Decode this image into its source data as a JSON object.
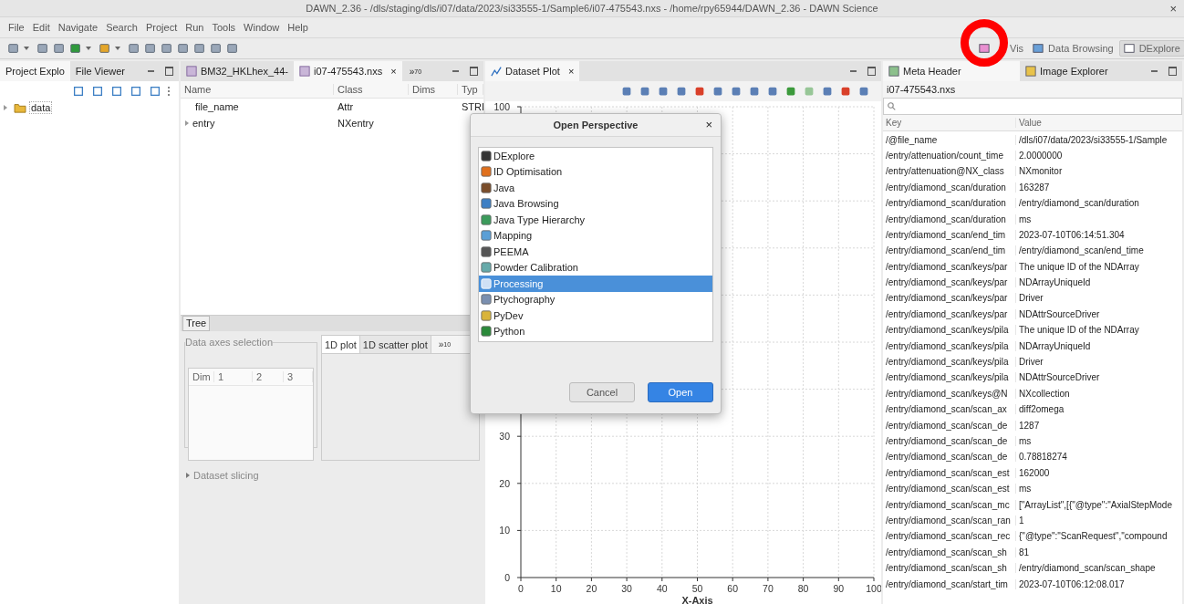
{
  "window": {
    "title": "DAWN_2.36 - /dls/staging/dls/i07/data/2023/si33555-1/Sample6/i07-475543.nxs - /home/rpy65944/DAWN_2.36 - DAWN Science",
    "close": "×"
  },
  "menu": [
    "File",
    "Edit",
    "Navigate",
    "Search",
    "Project",
    "Run",
    "Tools",
    "Window",
    "Help"
  ],
  "perspectives": [
    {
      "label": "Vis",
      "selected": false
    },
    {
      "label": "Data Browsing",
      "selected": false
    },
    {
      "label": "DExplore",
      "selected": true
    }
  ],
  "project_panel": {
    "tabs": [
      {
        "label": "Project Explo",
        "selected": true
      },
      {
        "label": "File Viewer",
        "selected": false
      }
    ],
    "tree": [
      {
        "label": "data",
        "expanded": false
      }
    ]
  },
  "nexus_panel": {
    "tabs": [
      {
        "label": "BM32_HKLhex_44-",
        "selected": false
      },
      {
        "label": "i07-475543.nxs",
        "selected": true,
        "close": "×"
      }
    ],
    "overflow": "»",
    "overflow_count": "70",
    "columns": [
      "Name",
      "Class",
      "Dims",
      "Typ"
    ],
    "rows": [
      {
        "cells": [
          "file_name",
          "Attr",
          "",
          "STRI"
        ],
        "expandable": false
      },
      {
        "cells": [
          "entry",
          "NXentry",
          "",
          ""
        ],
        "expandable": true
      }
    ],
    "bottom_tab": "Tree",
    "axes_group": "Data axes selection",
    "axes_columns": [
      "Dim",
      "1",
      "2",
      "3"
    ],
    "plot_tabs": [
      {
        "label": "1D plot",
        "selected": true
      },
      {
        "label": "1D scatter plot",
        "selected": false
      }
    ],
    "plot_overflow": "»",
    "plot_overflow_count": "10",
    "slicing": "Dataset slicing"
  },
  "plot_panel": {
    "tab": "Dataset Plot",
    "close": "×",
    "chart_data": {
      "type": "line",
      "grid": true,
      "xlabel": "X-Axis",
      "xlim": [
        0,
        100
      ],
      "ylim": [
        0,
        100
      ],
      "xticks": [
        0,
        10,
        20,
        30,
        40,
        50,
        60,
        70,
        80,
        90,
        100
      ],
      "yticks": [
        0,
        10,
        20,
        30,
        100
      ]
    }
  },
  "meta_panel": {
    "tabs": [
      {
        "label": "Meta Header",
        "selected": true
      },
      {
        "label": "Image Explorer",
        "selected": false
      }
    ],
    "file": "i07-475543.nxs",
    "columns": [
      "Key",
      "Value"
    ],
    "rows": [
      [
        "/@file_name",
        "/dls/i07/data/2023/si33555-1/Sample"
      ],
      [
        "/entry/attenuation/count_time",
        "2.0000000"
      ],
      [
        "/entry/attenuation@NX_class",
        "NXmonitor"
      ],
      [
        "/entry/diamond_scan/duration",
        "163287"
      ],
      [
        "/entry/diamond_scan/duration",
        "/entry/diamond_scan/duration"
      ],
      [
        "/entry/diamond_scan/duration",
        "ms"
      ],
      [
        "/entry/diamond_scan/end_tim",
        "2023-07-10T06:14:51.304"
      ],
      [
        "/entry/diamond_scan/end_tim",
        "/entry/diamond_scan/end_time"
      ],
      [
        "/entry/diamond_scan/keys/par",
        "The unique ID of the NDArray"
      ],
      [
        "/entry/diamond_scan/keys/par",
        "NDArrayUniqueId"
      ],
      [
        "/entry/diamond_scan/keys/par",
        "Driver"
      ],
      [
        "/entry/diamond_scan/keys/par",
        "NDAttrSourceDriver"
      ],
      [
        "/entry/diamond_scan/keys/pila",
        "The unique ID of the NDArray"
      ],
      [
        "/entry/diamond_scan/keys/pila",
        "NDArrayUniqueId"
      ],
      [
        "/entry/diamond_scan/keys/pila",
        "Driver"
      ],
      [
        "/entry/diamond_scan/keys/pila",
        "NDAttrSourceDriver"
      ],
      [
        "/entry/diamond_scan/keys@N",
        "NXcollection"
      ],
      [
        "/entry/diamond_scan/scan_ax",
        "diff2omega"
      ],
      [
        "/entry/diamond_scan/scan_de",
        "1287"
      ],
      [
        "/entry/diamond_scan/scan_de",
        "ms"
      ],
      [
        "/entry/diamond_scan/scan_de",
        "0.78818274"
      ],
      [
        "/entry/diamond_scan/scan_est",
        "162000"
      ],
      [
        "/entry/diamond_scan/scan_est",
        "ms"
      ],
      [
        "/entry/diamond_scan/scan_mc",
        "[\"ArrayList\",[{\"@type\":\"AxialStepMode"
      ],
      [
        "/entry/diamond_scan/scan_ran",
        "1"
      ],
      [
        "/entry/diamond_scan/scan_rec",
        "{\"@type\":\"ScanRequest\",\"compound"
      ],
      [
        "/entry/diamond_scan/scan_sh",
        "81"
      ],
      [
        "/entry/diamond_scan/scan_sh",
        "/entry/diamond_scan/scan_shape"
      ],
      [
        "/entry/diamond_scan/start_tim",
        "2023-07-10T06:12:08.017"
      ]
    ]
  },
  "dialog": {
    "title": "Open Perspective",
    "close": "×",
    "items": [
      {
        "label": "DExplore",
        "selected": false
      },
      {
        "label": "ID Optimisation",
        "selected": false
      },
      {
        "label": "Java",
        "selected": false
      },
      {
        "label": "Java Browsing",
        "selected": false
      },
      {
        "label": "Java Type Hierarchy",
        "selected": false
      },
      {
        "label": "Mapping",
        "selected": false
      },
      {
        "label": "PEEMA",
        "selected": false
      },
      {
        "label": "Powder Calibration",
        "selected": false
      },
      {
        "label": "Processing",
        "selected": true
      },
      {
        "label": "Ptychography",
        "selected": false
      },
      {
        "label": "PyDev",
        "selected": false
      },
      {
        "label": "Python",
        "selected": false
      }
    ],
    "buttons": [
      {
        "label": "Cancel",
        "kind": "secondary"
      },
      {
        "label": "Open",
        "kind": "primary"
      }
    ]
  }
}
